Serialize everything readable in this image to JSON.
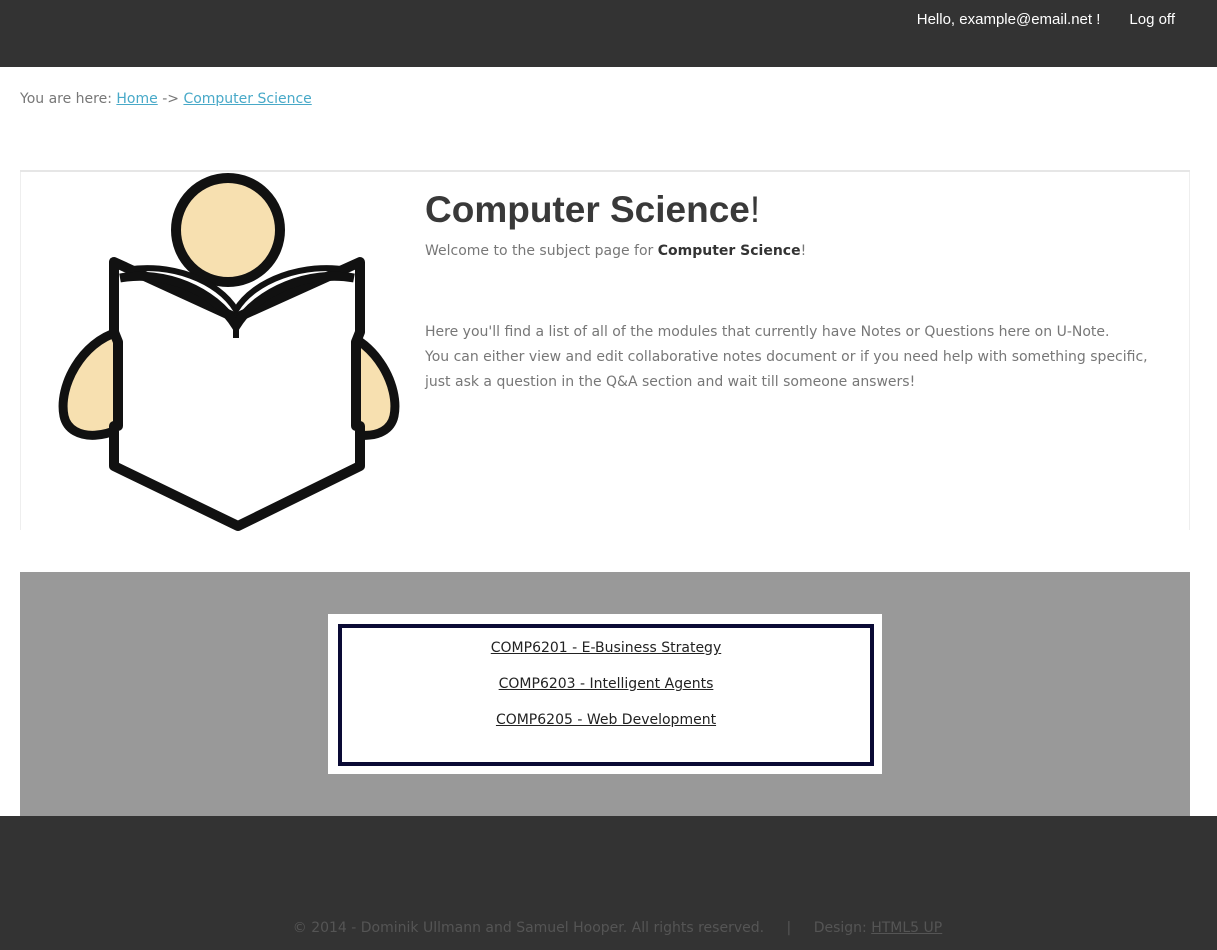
{
  "header": {
    "greeting": "Hello, example@email.net !",
    "logoff_label": "Log off"
  },
  "breadcrumb": {
    "prefix": "You are here:",
    "home_label": "Home",
    "separator": "->",
    "current_label": "Computer Science"
  },
  "banner": {
    "title": "Computer Science",
    "title_suffix": "!",
    "welcome_prefix": "Welcome to the subject page for",
    "welcome_subject": "Computer Science",
    "welcome_suffix": "!",
    "desc_line1": "Here you'll find a list of all of the modules that currently have Notes or Questions here on U-Note.",
    "desc_line2": "You can either view and edit collaborative notes document or if you need help with something specific, just ask a question in the Q&A section and wait till someone answers!",
    "image_icon": "reading-person-icon"
  },
  "modules": [
    {
      "label": "COMP6201 - E-Business Strategy"
    },
    {
      "label": "COMP6203 - Intelligent Agents"
    },
    {
      "label": "COMP6205 - Web Development"
    }
  ],
  "footer": {
    "copyright": "© 2014 - Dominik Ullmann and Samuel Hooper. All rights reserved.",
    "separator": "|",
    "design_prefix": "Design:",
    "design_link": "HTML5 UP"
  },
  "colors": {
    "header_bg": "#333333",
    "link_blue": "#48a9c8",
    "band_grey": "#999999",
    "module_border": "#0a0a35"
  }
}
